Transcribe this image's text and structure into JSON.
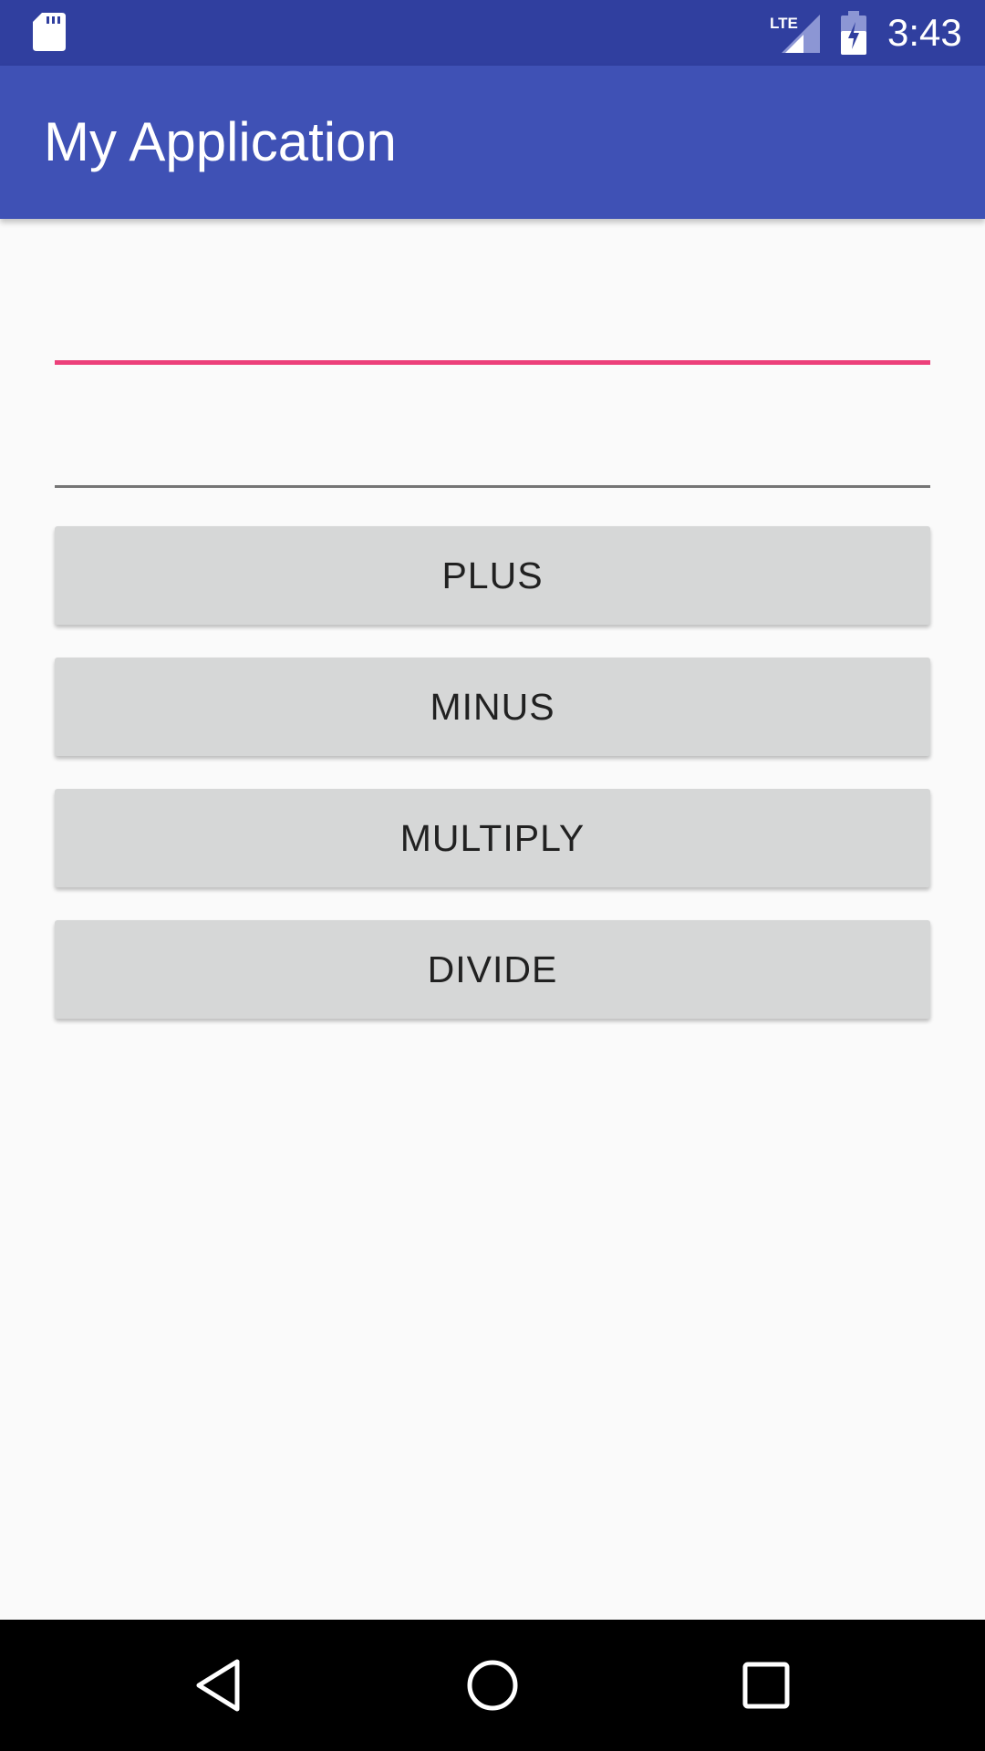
{
  "status_bar": {
    "time": "3:43",
    "network": "LTE",
    "icons": [
      "sd-card-icon",
      "lte-signal-icon",
      "battery-charging-icon"
    ],
    "color": "#303f9f"
  },
  "app_bar": {
    "title": "My Application",
    "color": "#3f51b5"
  },
  "form": {
    "first_field": {
      "value": "",
      "placeholder": "",
      "focused": true,
      "accent": "#ec407a"
    },
    "second_field": {
      "value": "",
      "placeholder": "",
      "focused": false
    }
  },
  "buttons": {
    "plus": "PLUS",
    "minus": "MINUS",
    "multiply": "MULTIPLY",
    "divide": "DIVIDE"
  },
  "nav_bar": {
    "icons": [
      "back-icon",
      "home-icon",
      "recents-icon"
    ]
  }
}
